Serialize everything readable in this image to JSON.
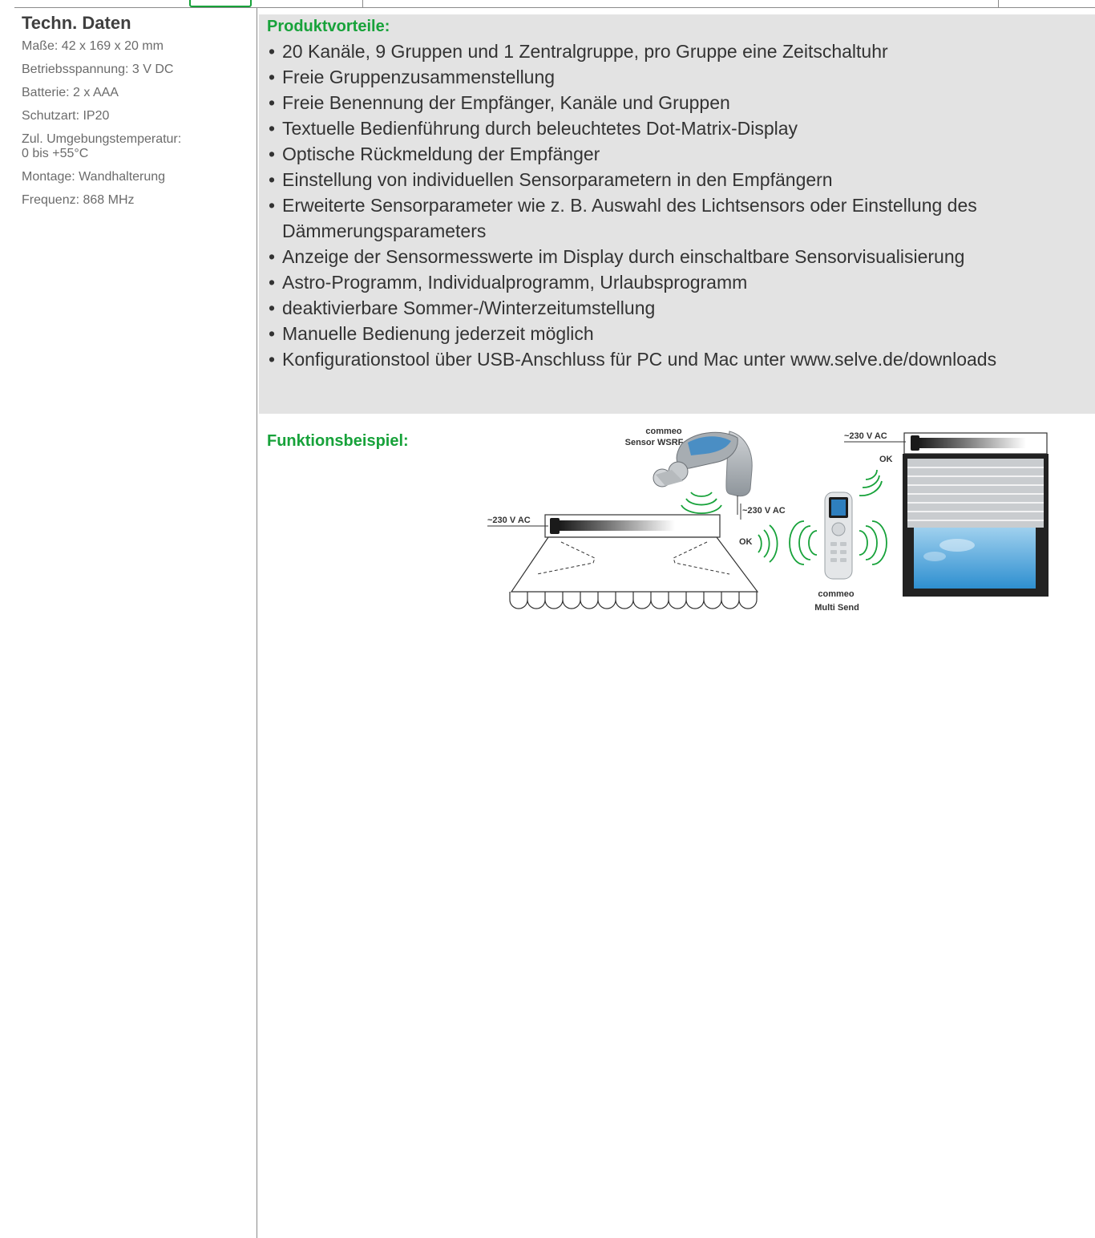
{
  "techn_daten": {
    "title": "Techn. Daten",
    "items": [
      "Maße: 42 x 169 x 20 mm",
      "Betriebsspannung: 3 V DC",
      "Batterie: 2 x AAA",
      "Schutzart: IP20",
      "Zul. Umgebungstemperatur:\n0 bis +55°C",
      "Montage: Wandhalterung",
      "Frequenz: 868 MHz"
    ]
  },
  "produktvorteile": {
    "title": "Produktvorteile:",
    "bullet": "•",
    "items": [
      "20 Kanäle, 9 Gruppen und 1 Zentralgruppe, pro Gruppe eine Zeitschaltuhr",
      "Freie Gruppenzusammenstellung",
      "Freie Benennung der Empfänger, Kanäle und Gruppen",
      "Textuelle Bedienführung durch beleuchtetes Dot-Matrix-Display",
      "Optische Rückmeldung der Empfänger",
      "Einstellung von individuellen Sensorparametern in den Empfängern",
      "Erweiterte Sensorparameter wie z. B. Auswahl des Lichtsensors oder Einstellung des Dämmerungsparameters",
      "Anzeige der Sensormesswerte im Display durch einschaltbare Sensorvisualisierung",
      "Astro-Programm, Individualprogramm, Urlaubsprogramm",
      "deaktivierbare Sommer-/Winterzeitumstellung",
      "Manuelle Bedienung jederzeit möglich",
      "Konfigurationstool über USB-Anschluss für PC und Mac unter www.selve.de/downloads"
    ]
  },
  "funktionsbeispiel": {
    "title": "Funktionsbeispiel:",
    "labels": {
      "sensor_line1": "commeo",
      "sensor_line2": "Sensor WSRF",
      "remote_line1": "commeo",
      "remote_line2": "Multi Send",
      "voltage_awning": "~230 V AC",
      "voltage_sensor": "~230 V AC",
      "voltage_shutter": "~230 V AC",
      "ok_awning": "OK",
      "ok_shutter": "OK"
    }
  },
  "colors": {
    "accent_green": "#17a23a",
    "panel_grey": "#e3e3e3",
    "text_dark": "#333333",
    "text_muted": "#6b6b6b"
  }
}
